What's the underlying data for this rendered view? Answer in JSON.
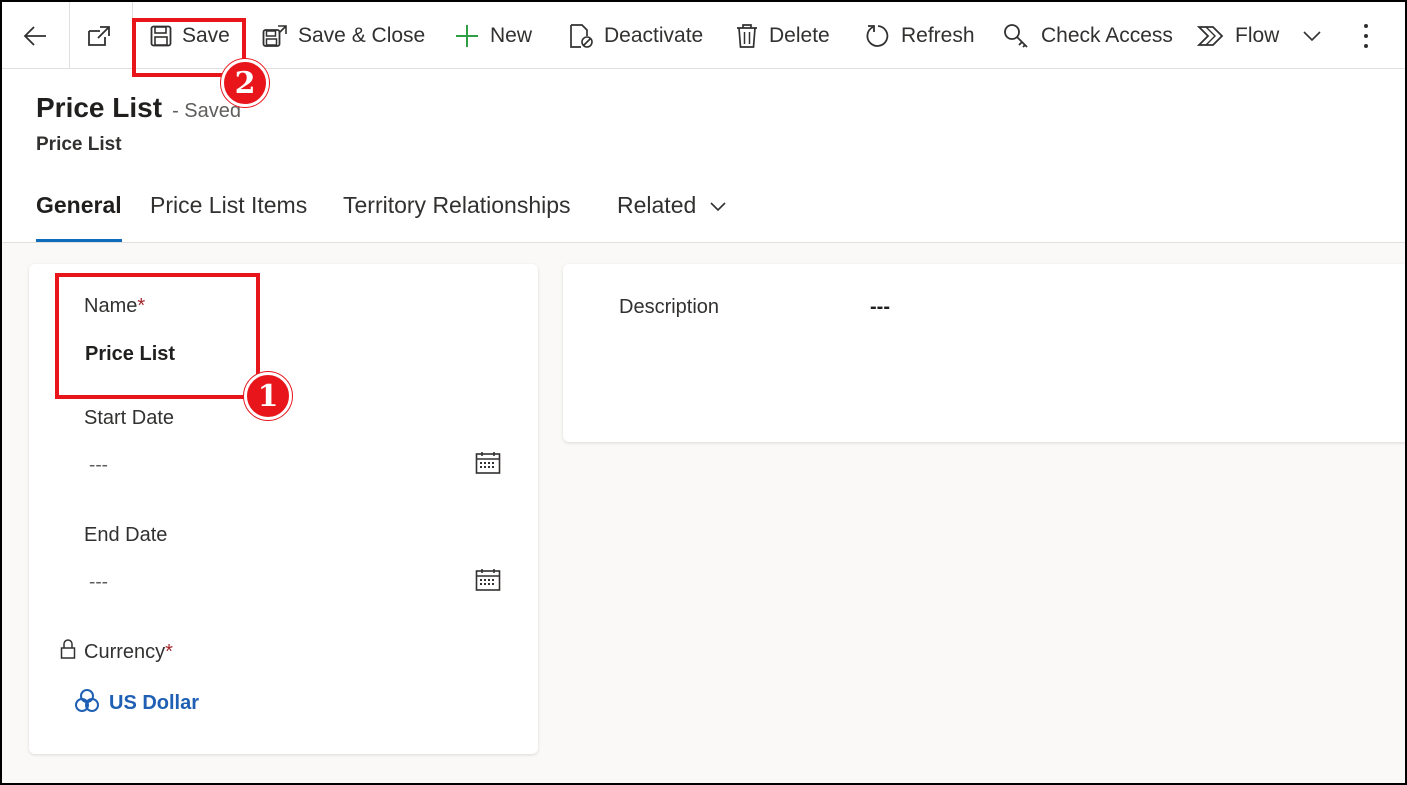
{
  "toolbar": {
    "save": "Save",
    "save_close": "Save & Close",
    "new": "New",
    "deactivate": "Deactivate",
    "delete": "Delete",
    "refresh": "Refresh",
    "check_access": "Check Access",
    "flow": "Flow"
  },
  "header": {
    "title": "Price List",
    "status": "- Saved",
    "entity": "Price List"
  },
  "tabs": {
    "general": "General",
    "items": "Price List Items",
    "territory": "Territory Relationships",
    "related": "Related"
  },
  "form": {
    "name_label": "Name",
    "required_mark": "*",
    "name_value": "Price List",
    "start_label": "Start Date",
    "start_value": "---",
    "end_label": "End Date",
    "end_value": "---",
    "currency_label": "Currency",
    "currency_value": "US Dollar",
    "description_label": "Description",
    "description_value": "---"
  },
  "annotations": {
    "badge1": "1",
    "badge2": "2",
    "color": "#e8151b"
  },
  "colors": {
    "accent": "#0f6cbd",
    "link": "#1f5fb4",
    "required": "#a4262c"
  }
}
